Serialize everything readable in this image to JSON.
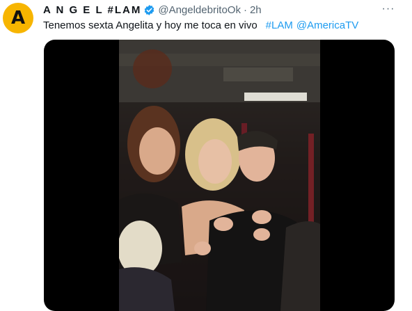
{
  "author": {
    "avatar_letter": "A",
    "display_name": "A N G E L #LAM",
    "verified_icon": "verified-badge-icon",
    "handle": "@AngeldebritoOk",
    "separator": "·",
    "time": "2h"
  },
  "more_menu": {
    "icon": "more-horizontal-icon",
    "label": "···"
  },
  "tweet": {
    "text": "Tenemos sexta Angelita y hoy me toca en vivo",
    "hashtag": "#LAM",
    "mention": "@AmericaTV"
  },
  "media": {
    "type": "video"
  },
  "colors": {
    "avatar_bg": "#f7b500",
    "link": "#1d9bf0",
    "secondary_text": "#536471",
    "primary_text": "#0f1419"
  }
}
